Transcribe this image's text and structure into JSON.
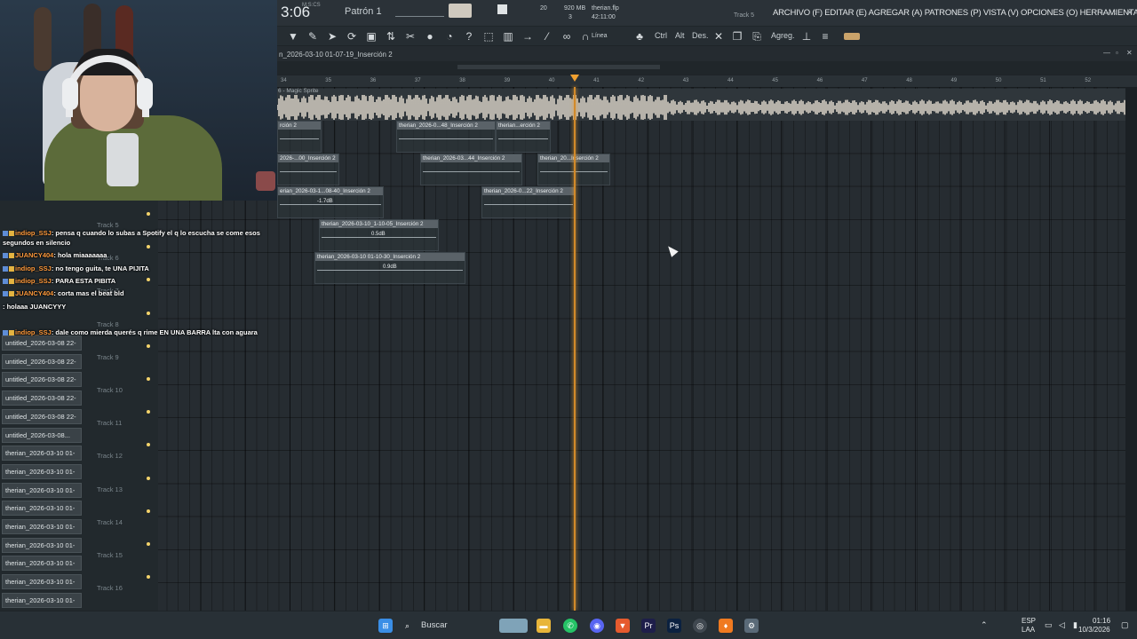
{
  "transport": {
    "time": "3:06",
    "time_small": "M:S:CS",
    "pattern": "Patrón 1"
  },
  "stats": {
    "cpu": "20",
    "memory": "920 MB",
    "voices": "3",
    "project": "therian.flp",
    "duration": "42:11:00"
  },
  "hint": {
    "track_label": "Track 5"
  },
  "menu": {
    "items": "ARCHIVO (F) EDITAR (E) AGREGAR (A) PATRONES (P) VISTA (V) OPCIONES (O) HERRAMIENTAS (T) AYUDA"
  },
  "toolbar": {
    "line_label": "Línea",
    "ctrl_label": "Ctrl",
    "alt_label": "Alt",
    "des_label": "Des.",
    "agreg_label": "Agreg."
  },
  "breadcrumb": {
    "path": "n_2026-03-10 01-07-19_Inserción 2"
  },
  "ruler": {
    "bars": [
      "34",
      "35",
      "36",
      "37",
      "38",
      "39",
      "40",
      "41",
      "42",
      "43",
      "44",
      "45",
      "46",
      "47",
      "48",
      "49",
      "50",
      "51",
      "52"
    ]
  },
  "playlist": {
    "track1_label": "6 - Magic Sprite",
    "clips": [
      {
        "label": "rción 2"
      },
      {
        "label": "therian_2026-0...48_Inserción 2"
      },
      {
        "label": "therian...erción 2"
      },
      {
        "label": "2026-...00_Inserción 2"
      },
      {
        "label": "therian_2026-03...44_Inserción 2"
      },
      {
        "label": "therian_20...Inserción 2"
      },
      {
        "label": "erian_2026-03-1...08-40_Inserción 2",
        "gain": "-1.7dB"
      },
      {
        "label": "therian_2026-0...22_Inserción 2"
      },
      {
        "label": "therian_2026-03-10_1-10-05_Inserción 2",
        "gain": "0.5dB"
      },
      {
        "label": "therian_2026-03-10 01-10-30_Inserción 2",
        "gain": "0.9dB"
      }
    ]
  },
  "tracks": [
    "Track 5",
    "Track 6",
    "Track 7",
    "Track 8",
    "Track 9",
    "Track 10",
    "Track 11",
    "Track 12",
    "Track 13",
    "Track 14",
    "Track 15",
    "Track 16"
  ],
  "browser": {
    "items": [
      "untitled_2026-03-08 22-",
      "untitled_2026-03-08 22-",
      "untitled_2026-03-08 22-",
      "untitled_2026-03-08 22-",
      "untitled_2026-03-08 22-",
      "untitled_2026-03-08...",
      "therian_2026-03-10 01-",
      "therian_2026-03-10 01-",
      "therian_2026-03-10 01-",
      "therian_2026-03-10 01-",
      "therian_2026-03-10 01-",
      "therian_2026-03-10 01-",
      "therian_2026-03-10 01-",
      "therian_2026-03-10 01-",
      "therian_2026-03-10 01-"
    ]
  },
  "chat": {
    "messages": [
      {
        "user": "indiop_SSJ",
        "text": ": pensa q cuando lo subas a Spotify el q lo escucha se come esos"
      },
      {
        "user": "",
        "text": "segundos en silencio"
      },
      {
        "user": "JUANCY404",
        "text": ": hola miaaaaaaa"
      },
      {
        "user": "indiop_SSJ",
        "text": ": no tengo guita, te UNA PIJITA"
      },
      {
        "user": "indiop_SSJ",
        "text": ": PARA ESTA PIBITA"
      },
      {
        "user": "JUANCY404",
        "text": ": corta mas el beat bld"
      },
      {
        "user": "",
        "text": ": holaaa JUANCYYY"
      },
      {
        "user": "indiop_SSJ",
        "text": ": dale como mierda querés q rime EN UNA BARRA lta con aguara"
      }
    ]
  },
  "taskbar": {
    "search": "Buscar",
    "lang": "ESP",
    "lang2": "LAA",
    "clock": "01:16",
    "date": "10/3/2026"
  },
  "colors": {
    "accent": "#f0a030",
    "bg": "#262c31",
    "clip_header": "#5a6268"
  }
}
